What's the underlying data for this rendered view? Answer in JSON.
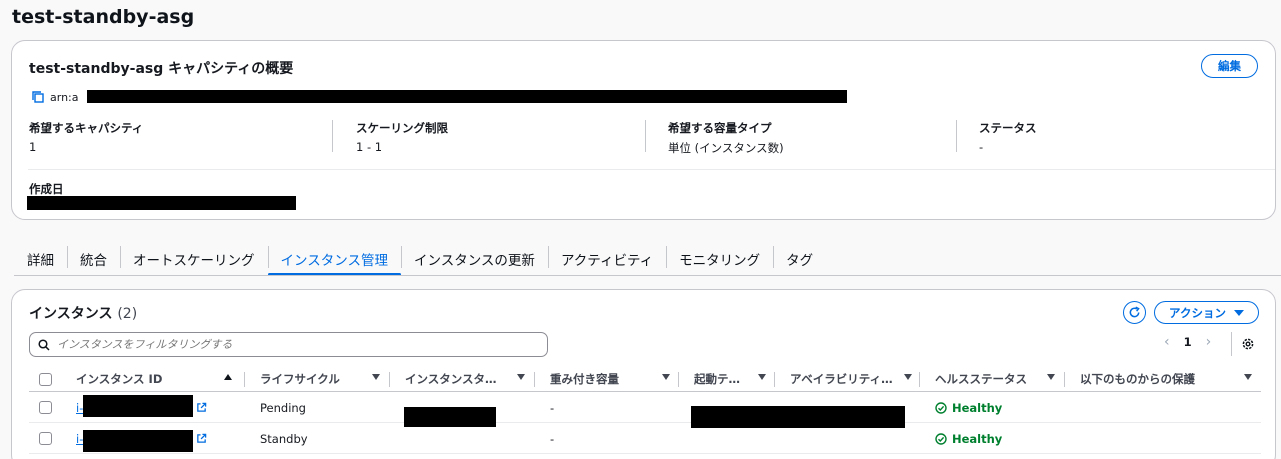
{
  "page": {
    "title": "test-standby-asg"
  },
  "capacity": {
    "title": "test-standby-asg キャパシティの概要",
    "edit_label": "編集",
    "arn_prefix": "arn:a",
    "desired_capacity": {
      "label": "希望するキャパシティ",
      "value": "1"
    },
    "scaling_limits": {
      "label": "スケーリング制限",
      "value": "1 - 1"
    },
    "capacity_type": {
      "label": "希望する容量タイプ",
      "value": "単位 (インスタンス数)"
    },
    "status": {
      "label": "ステータス",
      "value": "-"
    },
    "created": {
      "label": "作成日"
    }
  },
  "tabs": [
    {
      "label": "詳細"
    },
    {
      "label": "統合"
    },
    {
      "label": "オートスケーリング"
    },
    {
      "label": "インスタンス管理",
      "active": true
    },
    {
      "label": "インスタンスの更新"
    },
    {
      "label": "アクティビティ"
    },
    {
      "label": "モニタリング"
    },
    {
      "label": "タグ"
    }
  ],
  "instances": {
    "title": "インスタンス",
    "count": "(2)",
    "action_label": "アクション",
    "filter_placeholder": "インスタンスをフィルタリングする",
    "page": "1",
    "columns": [
      "インスタンス ID",
      "ライフサイクル",
      "インスタンスタ…",
      "重み付き容量",
      "起動テ…",
      "アベイラビリティ…",
      "ヘルスステータス",
      "以下のものからの保護"
    ],
    "rows": [
      {
        "id_prefix": "i-",
        "lifecycle": "Pending",
        "weighted": "-",
        "health": "Healthy"
      },
      {
        "id_prefix": "i-",
        "lifecycle": "Standby",
        "weighted": "-",
        "health": "Healthy"
      }
    ]
  },
  "colors": {
    "accent": "#006ce0",
    "healthy": "#00802f"
  }
}
